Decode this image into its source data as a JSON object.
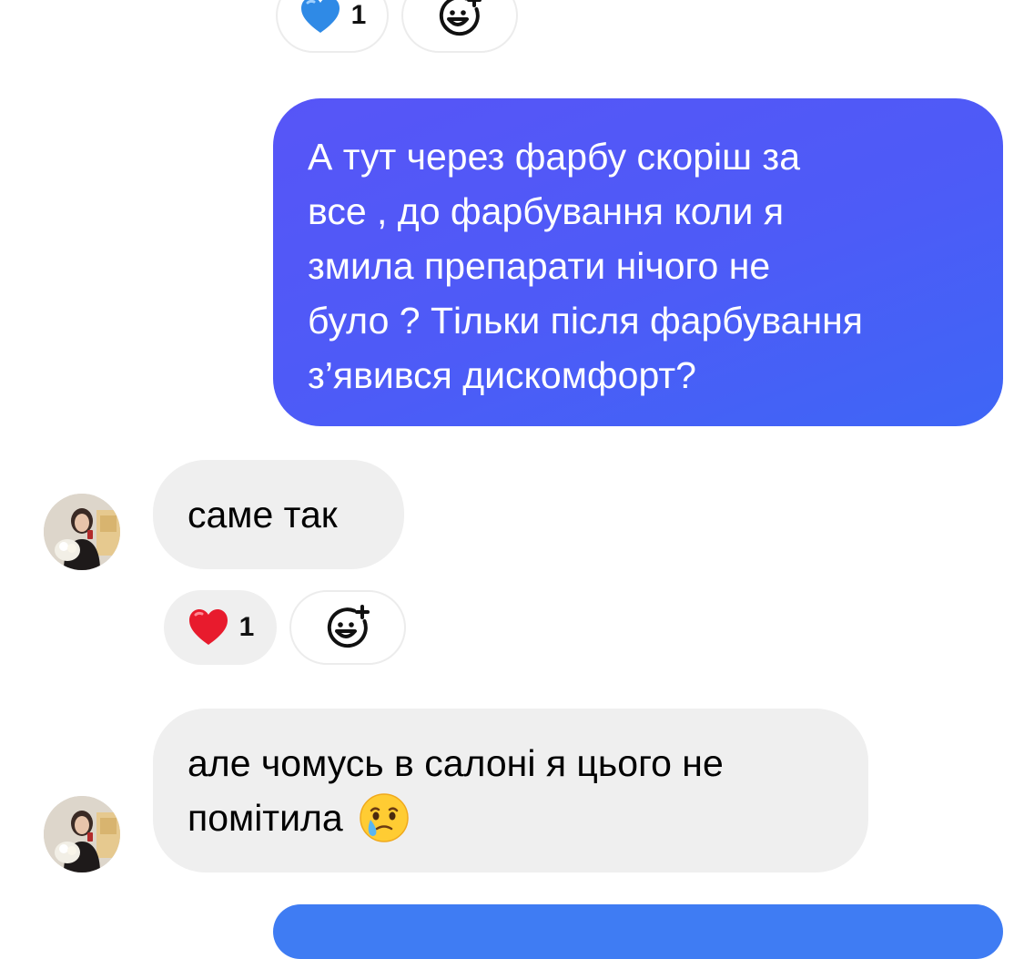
{
  "thread": {
    "top_reactions": {
      "reaction_emoji": "blue-heart",
      "reaction_count": "1",
      "add_reaction_icon": "add-reaction-icon"
    },
    "outgoing_message": {
      "lines": [
        "А тут через фарбу скоріш за",
        "все , до фарбування коли я",
        "змила препарати нічого не",
        "було ? Тільки після фарбування",
        "з’явився дискомфорт?"
      ],
      "bubble_colors": [
        "#5755f7",
        "#3e66f6"
      ]
    },
    "incoming_message_1": {
      "text": "саме так",
      "reaction_emoji": "red-heart",
      "reaction_count": "1",
      "add_reaction_icon": "add-reaction-icon"
    },
    "incoming_message_2": {
      "line1": "але чомусь в салоні я цього не",
      "line2": "помітила",
      "emoji": "face-holding-back-tears"
    }
  },
  "colors": {
    "incoming_bubble": "#efefef",
    "outgoing_accent": "#4d5bf7",
    "next_bubble": "#3f7cf3"
  }
}
